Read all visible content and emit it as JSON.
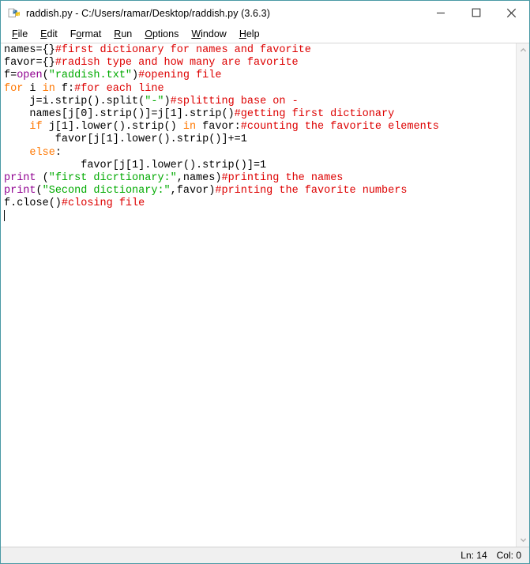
{
  "window": {
    "title": "raddish.py - C:/Users/ramar/Desktop/raddish.py (3.6.3)",
    "icon": "python-idle-icon",
    "controls": {
      "minimize": "—",
      "maximize": "□",
      "close": "✕"
    },
    "border_color": "#4a9aa5"
  },
  "menubar": {
    "items": [
      {
        "label": "File",
        "mnemonic": "F"
      },
      {
        "label": "Edit",
        "mnemonic": "E"
      },
      {
        "label": "Format",
        "mnemonic": "o"
      },
      {
        "label": "Run",
        "mnemonic": "R"
      },
      {
        "label": "Options",
        "mnemonic": "O"
      },
      {
        "label": "Window",
        "mnemonic": "W"
      },
      {
        "label": "Help",
        "mnemonic": "H"
      }
    ]
  },
  "editor": {
    "filename": "raddish.py",
    "syntax_colors": {
      "keyword": "#ff7700",
      "builtin": "#900090",
      "string": "#00aa00",
      "comment": "#dd0000",
      "plain": "#000000"
    },
    "lines": [
      {
        "n": 1,
        "tokens": [
          {
            "t": "plain",
            "v": "names={}"
          },
          {
            "t": "comment",
            "v": "#first dictionary for names and favorite"
          }
        ]
      },
      {
        "n": 2,
        "tokens": [
          {
            "t": "plain",
            "v": "favor={}"
          },
          {
            "t": "comment",
            "v": "#radish type and how many are favorite"
          }
        ]
      },
      {
        "n": 3,
        "tokens": [
          {
            "t": "plain",
            "v": "f="
          },
          {
            "t": "builtin",
            "v": "open"
          },
          {
            "t": "plain",
            "v": "("
          },
          {
            "t": "string",
            "v": "\"raddish.txt\""
          },
          {
            "t": "plain",
            "v": ")"
          },
          {
            "t": "comment",
            "v": "#opening file"
          }
        ]
      },
      {
        "n": 4,
        "tokens": [
          {
            "t": "keyword",
            "v": "for"
          },
          {
            "t": "plain",
            "v": " i "
          },
          {
            "t": "keyword",
            "v": "in"
          },
          {
            "t": "plain",
            "v": " f:"
          },
          {
            "t": "comment",
            "v": "#for each line"
          }
        ]
      },
      {
        "n": 5,
        "tokens": [
          {
            "t": "plain",
            "v": "    j=i.strip().split("
          },
          {
            "t": "string",
            "v": "\"-\""
          },
          {
            "t": "plain",
            "v": ")"
          },
          {
            "t": "comment",
            "v": "#splitting base on -"
          }
        ]
      },
      {
        "n": 6,
        "tokens": [
          {
            "t": "plain",
            "v": "    names[j[0].strip()]=j[1].strip()"
          },
          {
            "t": "comment",
            "v": "#getting first dictionary"
          }
        ]
      },
      {
        "n": 7,
        "tokens": [
          {
            "t": "plain",
            "v": "    "
          },
          {
            "t": "keyword",
            "v": "if"
          },
          {
            "t": "plain",
            "v": " j[1].lower().strip() "
          },
          {
            "t": "keyword",
            "v": "in"
          },
          {
            "t": "plain",
            "v": " favor:"
          },
          {
            "t": "comment",
            "v": "#counting the favorite elements"
          }
        ]
      },
      {
        "n": 8,
        "tokens": [
          {
            "t": "plain",
            "v": "        favor[j[1].lower().strip()]+=1"
          }
        ]
      },
      {
        "n": 9,
        "tokens": [
          {
            "t": "plain",
            "v": "    "
          },
          {
            "t": "keyword",
            "v": "else"
          },
          {
            "t": "plain",
            "v": ":"
          }
        ]
      },
      {
        "n": 10,
        "tokens": [
          {
            "t": "plain",
            "v": "            favor[j[1].lower().strip()]=1"
          }
        ]
      },
      {
        "n": 11,
        "tokens": [
          {
            "t": "builtin",
            "v": "print"
          },
          {
            "t": "plain",
            "v": " ("
          },
          {
            "t": "string",
            "v": "\"first dicrtionary:\""
          },
          {
            "t": "plain",
            "v": ",names)"
          },
          {
            "t": "comment",
            "v": "#printing the names"
          }
        ]
      },
      {
        "n": 12,
        "tokens": [
          {
            "t": "builtin",
            "v": "print"
          },
          {
            "t": "plain",
            "v": "("
          },
          {
            "t": "string",
            "v": "\"Second dictionary:\""
          },
          {
            "t": "plain",
            "v": ",favor)"
          },
          {
            "t": "comment",
            "v": "#printing the favorite numbers"
          }
        ]
      },
      {
        "n": 13,
        "tokens": [
          {
            "t": "plain",
            "v": "f.close()"
          },
          {
            "t": "comment",
            "v": "#closing file"
          }
        ]
      },
      {
        "n": 14,
        "tokens": [],
        "caret": true
      }
    ]
  },
  "scrollbar": {
    "up_arrow": "chevron-up",
    "down_arrow": "chevron-down"
  },
  "statusbar": {
    "line": "Ln: 14",
    "column": "Col: 0"
  }
}
